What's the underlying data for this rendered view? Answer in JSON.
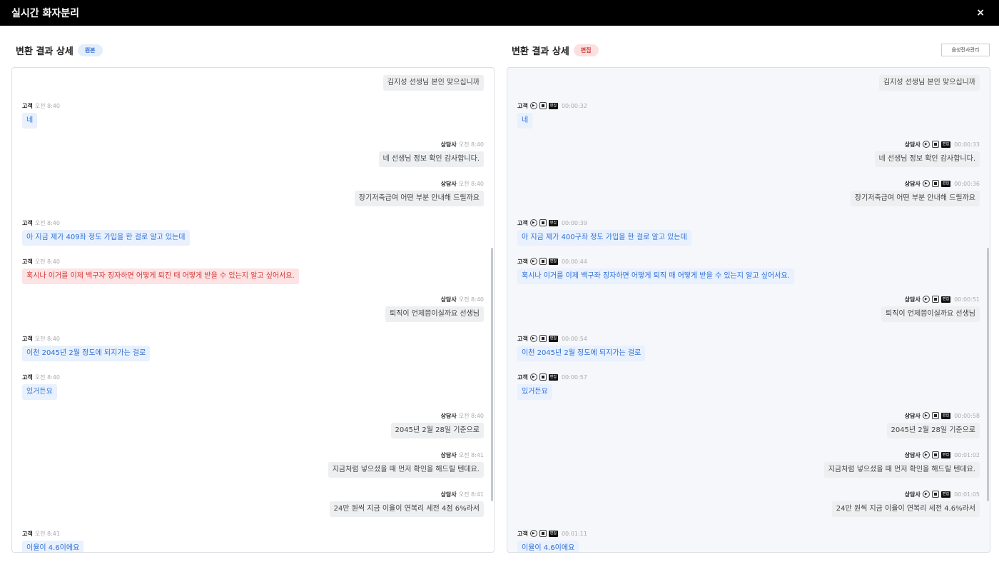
{
  "window": {
    "title": "실시간 화자분리",
    "close_label": "×"
  },
  "left_panel": {
    "title": "변환 결과 상세",
    "badge": "원본"
  },
  "right_panel": {
    "title": "변환 결과 상세",
    "badge": "편집",
    "manage_button": "음성전사관리",
    "edit_tag": "편집"
  },
  "left_messages": [
    {
      "speaker": "",
      "time": "",
      "text": "김지성 선생님 본인 맞으십니까"
    },
    {
      "speaker": "고객",
      "time": "오전 8:40",
      "text": "네"
    },
    {
      "speaker": "상담사",
      "time": "오전 8:40",
      "text": "네 선생님 정보 확인 감사합니다."
    },
    {
      "speaker": "상담사",
      "time": "오전 8:40",
      "text": "장기저축급여 어떤 부분 안내해 드릴까요"
    },
    {
      "speaker": "고객",
      "time": "오전 8:40",
      "text": "아 지금 제가 409좌 정도 가입을 한 걸로 알고 있는데"
    },
    {
      "speaker": "고객",
      "time": "오전 8:40",
      "text": "혹시나 이거를 이제 백구자 징자하면 어떻게 퇴진 때 어떻게 받을 수 있는지 알고 싶어서요."
    },
    {
      "speaker": "상담사",
      "time": "오전 8:40",
      "text": "퇴직이 언제쯤이실까요 선생님"
    },
    {
      "speaker": "고객",
      "time": "오전 8:40",
      "text": "이천 2045년 2월 정도에 되지가는 걸로"
    },
    {
      "speaker": "고객",
      "time": "오전 8:40",
      "text": "있거든요"
    },
    {
      "speaker": "상담사",
      "time": "오전 8:40",
      "text": "2045년 2월 28일 기준으로"
    },
    {
      "speaker": "상담사",
      "time": "오전 8:41",
      "text": "지금처럼 넣으셨을 때 먼저 확인을 해드릴 텐데요."
    },
    {
      "speaker": "상담사",
      "time": "오전 8:41",
      "text": "24만 원씩 지금 이율이 연복리 세전 4점 6%라서"
    },
    {
      "speaker": "고객",
      "time": "오전 8:41",
      "text": "이율이 4.6이에요"
    }
  ],
  "right_messages": [
    {
      "speaker": "",
      "time": "",
      "text": "김지성 선생님 본인 맞으십니까"
    },
    {
      "speaker": "고객",
      "time": "00:00:32",
      "text": "네"
    },
    {
      "speaker": "상담사",
      "time": "00:00:33",
      "text": "네 선생님 정보 확인 감사합니다."
    },
    {
      "speaker": "상담사",
      "time": "00:00:36",
      "text": "장기저축급여 어떤 부분 안내해 드릴까요"
    },
    {
      "speaker": "고객",
      "time": "00:00:39",
      "text": "아 지금 제가 400구좌 정도 가입을 한 걸로 알고 있는데"
    },
    {
      "speaker": "고객",
      "time": "00:00:44",
      "text": "혹시나 이거를 이제 백구좌 징자하면 어떻게 퇴직 때 어떻게 받을 수 있는지 알고 싶어서요."
    },
    {
      "speaker": "상담사",
      "time": "00:00:51",
      "text": "퇴직이 언제쯤이실까요 선생님"
    },
    {
      "speaker": "고객",
      "time": "00:00:54",
      "text": "이천 2045년 2월 정도에 되지가는 걸로"
    },
    {
      "speaker": "고객",
      "time": "00:00:57",
      "text": "있거든요"
    },
    {
      "speaker": "상담사",
      "time": "00:00:58",
      "text": "2045년 2월 28일 기준으로"
    },
    {
      "speaker": "상담사",
      "time": "00:01:02",
      "text": "지금처럼 넣으셨을 때 먼저 확인을 해드릴 텐데요."
    },
    {
      "speaker": "상담사",
      "time": "00:01:05",
      "text": "24만 원씩 지금 이율이 연복리 세전 4.6%라서"
    },
    {
      "speaker": "고객",
      "time": "00:01:11",
      "text": "이율이 4.6이에요"
    }
  ]
}
